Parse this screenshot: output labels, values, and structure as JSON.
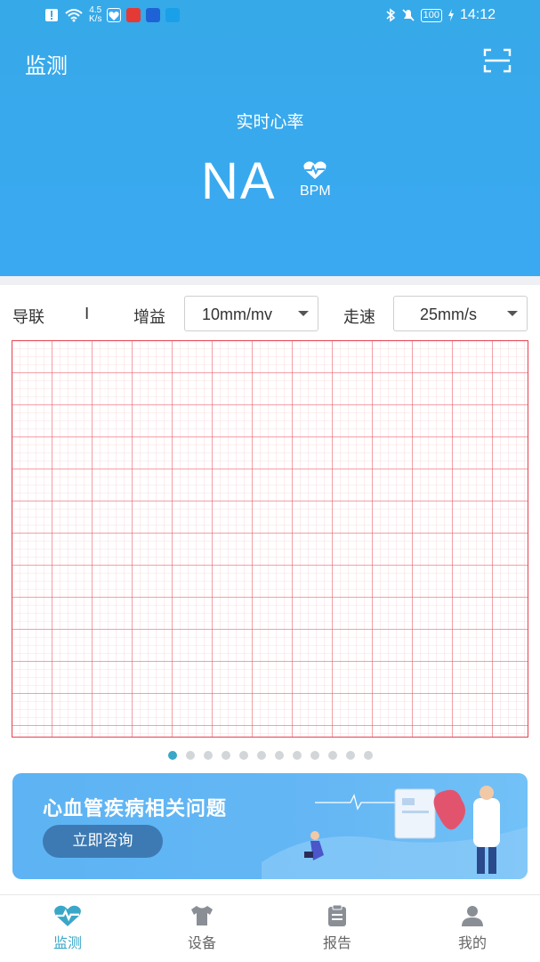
{
  "status_bar": {
    "net_speed_value": "4.5",
    "net_speed_unit": "K/s",
    "battery": "100",
    "time": "14:12"
  },
  "header": {
    "title": "监测",
    "heart_rate_label": "实时心率",
    "heart_rate_value": "NA",
    "heart_rate_unit": "BPM"
  },
  "controls": {
    "lead_label": "导联",
    "lead_value": "I",
    "gain_label": "增益",
    "gain_value": "10mm/mv",
    "speed_label": "走速",
    "speed_value": "25mm/s"
  },
  "carousel": {
    "page_count": 12,
    "active_index": 0
  },
  "banner": {
    "title": "心血管疾病相关问题",
    "button_label": "立即咨询"
  },
  "tabs": [
    {
      "label": "监测",
      "icon": "heart-pulse-icon",
      "active": true
    },
    {
      "label": "设备",
      "icon": "shirt-icon",
      "active": false
    },
    {
      "label": "报告",
      "icon": "clipboard-icon",
      "active": false
    },
    {
      "label": "我的",
      "icon": "person-icon",
      "active": false
    }
  ],
  "colors": {
    "header_blue": "#3ba9f2",
    "accent_teal": "#3aa7c8",
    "ecg_grid_red": "#e8414f"
  }
}
